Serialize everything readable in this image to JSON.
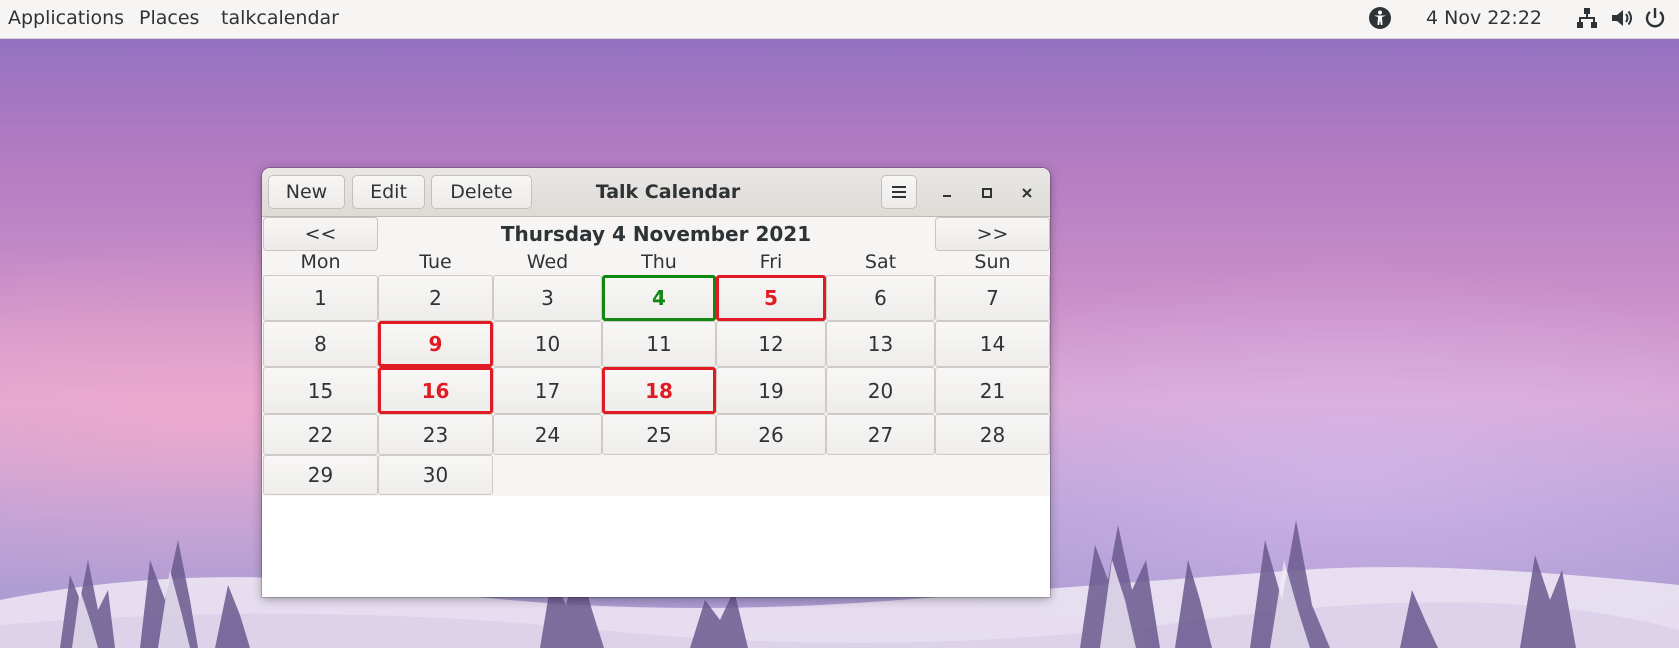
{
  "topbar": {
    "applications": "Applications",
    "places": "Places",
    "app_name": "talkcalendar",
    "clock": "4 Nov  22:22",
    "icons": [
      "accessibility-icon",
      "network-icon",
      "volume-icon",
      "power-icon"
    ]
  },
  "window": {
    "title": "Talk Calendar",
    "buttons": {
      "new": "New",
      "edit": "Edit",
      "delete": "Delete"
    },
    "menu_icon": "hamburger-menu-icon",
    "controls": [
      "minimize-icon",
      "maximize-icon",
      "close-icon"
    ]
  },
  "calendar": {
    "prev": "<<",
    "next": ">>",
    "heading": "Thursday 4 November 2021",
    "weekdays": [
      "Mon",
      "Tue",
      "Wed",
      "Thu",
      "Fri",
      "Sat",
      "Sun"
    ],
    "days": [
      "1",
      "2",
      "3",
      "4",
      "5",
      "6",
      "7",
      "8",
      "9",
      "10",
      "11",
      "12",
      "13",
      "14",
      "15",
      "16",
      "17",
      "18",
      "19",
      "20",
      "21",
      "22",
      "23",
      "24",
      "25",
      "26",
      "27",
      "28",
      "29",
      "30"
    ],
    "today": "4",
    "event_days": [
      "5",
      "9",
      "16",
      "18"
    ],
    "colors": {
      "today": "#118811",
      "event": "#e01b24"
    }
  }
}
